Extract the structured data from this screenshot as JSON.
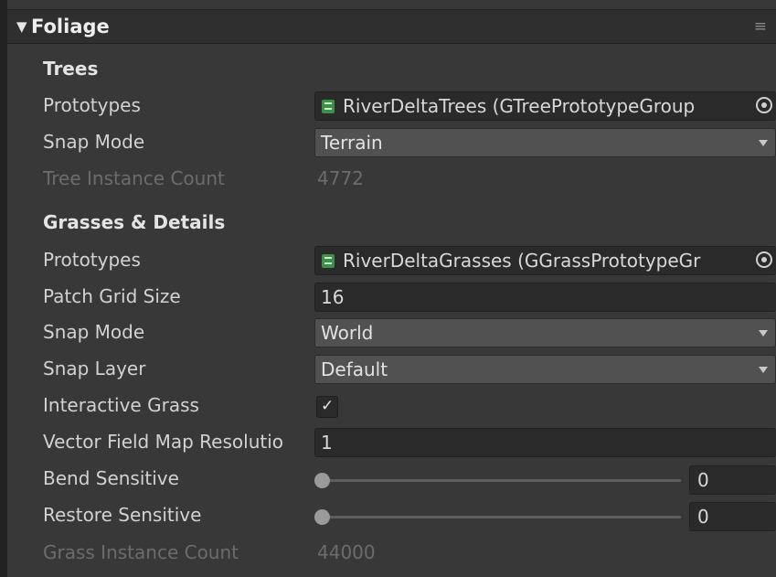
{
  "header": {
    "fold_glyph": "▼",
    "title": "Foliage",
    "menu_glyph": "≡"
  },
  "trees": {
    "section_label": "Trees",
    "prototypes": {
      "label": "Prototypes",
      "value": "RiverDeltaTrees (GTreePrototypeGroup"
    },
    "snap_mode": {
      "label": "Snap Mode",
      "value": "Terrain"
    },
    "instance_count": {
      "label": "Tree Instance Count",
      "value": "4772"
    }
  },
  "grasses": {
    "section_label": "Grasses & Details",
    "prototypes": {
      "label": "Prototypes",
      "value": "RiverDeltaGrasses (GGrassPrototypeGr"
    },
    "patch_grid_size": {
      "label": "Patch Grid Size",
      "value": "16"
    },
    "snap_mode": {
      "label": "Snap Mode",
      "value": "World"
    },
    "snap_layer": {
      "label": "Snap Layer",
      "value": "Default"
    },
    "interactive_grass": {
      "label": "Interactive Grass",
      "checked": true,
      "check_glyph": "✓"
    },
    "vector_field_res": {
      "label": "Vector Field Map Resolutio",
      "value": "1"
    },
    "bend_sensitive": {
      "label": "Bend Sensitive",
      "value": "0",
      "slider_fraction": 0
    },
    "restore_sensitive": {
      "label": "Restore Sensitive",
      "value": "0",
      "slider_fraction": 0
    },
    "instance_count": {
      "label": "Grass Instance Count",
      "value": "44000"
    }
  },
  "icons": {
    "fold": "triangle-down-icon",
    "menu": "hamburger-menu-icon",
    "tree_asset": "tree-prototype-asset-icon",
    "grass_asset": "grass-prototype-asset-icon",
    "object_picker": "object-picker-icon",
    "dropdown": "dropdown-caret-icon",
    "check": "checkmark-icon"
  },
  "colors": {
    "panel_bg": "#383838",
    "header_bg": "#2f2f2f",
    "field_bg": "#2a2a2a",
    "dropdown_bg": "#515151",
    "asset_icon_green": "#3f8f4a",
    "disabled_text": "#6c6c6c"
  }
}
